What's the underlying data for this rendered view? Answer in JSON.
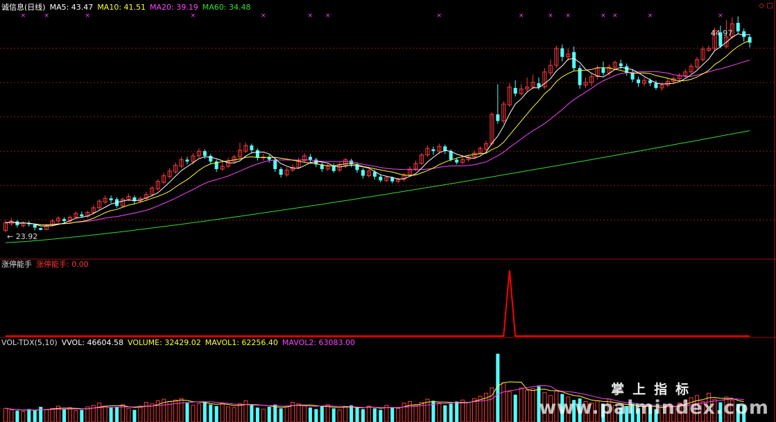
{
  "price_panel": {
    "title": "诚信息(日线)",
    "ma5_label": "MA5: 43.47",
    "ma10_label": "MA10: 41.51",
    "ma20_label": "MA20: 39.19",
    "ma60_label": "MA60: 34.48",
    "high_marker": "44.97",
    "low_marker": "← 23.92",
    "corner_diamond": "◇",
    "corner_box": "□"
  },
  "indicator_panel": {
    "name": "涨停能手",
    "value_label": "涨停能手: 0.00"
  },
  "volume_panel": {
    "name": "VOL-TDX(5,10)",
    "vvol_label": "VVOL: 46604.58",
    "volume_label": "VOLUME: 32429.02",
    "mavol1_label": "MAVOL1: 62256.40",
    "mavol2_label": "MAVOL2: 63083.00"
  },
  "watermark": {
    "cn": "掌上指标",
    "url": "www.palmindex.com"
  },
  "colors": {
    "background": "#000000",
    "up": "#ff3b3b",
    "down": "#54ffff",
    "ma5": "#ffffff",
    "ma10": "#ffff33",
    "ma20": "#ff44ff",
    "ma60": "#33dd33",
    "grid": "#8a1a1a",
    "separator": "#a01010",
    "indicator": "#ff0000"
  },
  "chart_data": {
    "type": "candlestick",
    "price_range": [
      21,
      47
    ],
    "high": 44.97,
    "low": 23.92,
    "candles": [
      [
        23.9,
        24.7,
        25.0,
        23.7
      ],
      [
        24.6,
        24.9,
        25.2,
        24.4
      ],
      [
        24.85,
        24.45,
        25.0,
        24.2
      ],
      [
        24.4,
        24.7,
        24.9,
        24.2
      ],
      [
        24.7,
        24.55,
        24.9,
        24.3
      ],
      [
        24.5,
        24.2,
        24.6,
        23.9
      ],
      [
        24.15,
        23.95,
        24.2,
        23.92
      ],
      [
        24.0,
        24.4,
        24.6,
        23.92
      ],
      [
        24.5,
        24.9,
        25.1,
        24.3
      ],
      [
        24.9,
        25.2,
        25.4,
        24.7
      ],
      [
        25.1,
        24.9,
        25.3,
        24.6
      ],
      [
        24.9,
        25.3,
        25.5,
        24.7
      ],
      [
        25.3,
        25.7,
        25.9,
        25.1
      ],
      [
        25.6,
        25.4,
        25.9,
        25.2
      ],
      [
        25.4,
        25.8,
        26.0,
        25.2
      ],
      [
        25.8,
        26.3,
        26.6,
        25.6
      ],
      [
        26.3,
        27.0,
        27.2,
        26.1
      ],
      [
        26.9,
        27.3,
        27.6,
        26.7
      ],
      [
        27.3,
        27.1,
        27.6,
        26.8
      ],
      [
        27.2,
        26.5,
        27.4,
        26.3
      ],
      [
        26.5,
        27.2,
        27.4,
        26.3
      ],
      [
        27.2,
        27.5,
        27.8,
        27.0
      ],
      [
        27.4,
        27.0,
        27.6,
        26.7
      ],
      [
        27.0,
        27.3,
        27.5,
        26.8
      ],
      [
        27.3,
        27.7,
        28.0,
        27.1
      ],
      [
        27.7,
        28.4,
        28.6,
        27.5
      ],
      [
        28.3,
        29.1,
        29.3,
        28.1
      ],
      [
        29.0,
        29.7,
        30.0,
        28.8
      ],
      [
        29.6,
        30.2,
        30.5,
        29.4
      ],
      [
        30.1,
        30.8,
        31.1,
        29.9
      ],
      [
        30.7,
        31.4,
        31.7,
        30.5
      ],
      [
        31.4,
        31.2,
        31.7,
        30.9
      ],
      [
        31.2,
        31.8,
        32.1,
        30.9
      ],
      [
        31.8,
        32.3,
        32.6,
        31.6
      ],
      [
        32.3,
        31.8,
        32.5,
        31.5
      ],
      [
        31.8,
        31.2,
        32.0,
        30.9
      ],
      [
        31.2,
        30.4,
        31.4,
        30.1
      ],
      [
        30.4,
        30.7,
        31.1,
        30.2
      ],
      [
        30.7,
        31.2,
        31.6,
        30.5
      ],
      [
        31.2,
        31.7,
        31.9,
        31.0
      ],
      [
        31.7,
        32.4,
        33.2,
        31.5
      ],
      [
        32.3,
        32.9,
        33.2,
        32.1
      ],
      [
        32.9,
        32.4,
        33.1,
        32.1
      ],
      [
        32.4,
        31.6,
        32.6,
        31.3
      ],
      [
        31.6,
        31.7,
        32.0,
        31.3
      ],
      [
        31.7,
        31.4,
        31.9,
        31.1
      ],
      [
        31.4,
        30.4,
        31.6,
        30.1
      ],
      [
        30.4,
        29.8,
        30.6,
        29.5
      ],
      [
        29.8,
        30.3,
        30.6,
        29.6
      ],
      [
        30.3,
        30.6,
        30.9,
        30.1
      ],
      [
        30.6,
        31.3,
        31.6,
        30.4
      ],
      [
        31.3,
        31.8,
        32.1,
        31.1
      ],
      [
        31.7,
        31.4,
        32.0,
        31.1
      ],
      [
        31.4,
        30.9,
        31.6,
        30.6
      ],
      [
        30.9,
        30.4,
        31.1,
        30.1
      ],
      [
        30.4,
        30.7,
        31.0,
        30.2
      ],
      [
        30.7,
        30.2,
        31.0,
        30.0
      ],
      [
        30.3,
        30.9,
        31.1,
        30.1
      ],
      [
        30.8,
        31.4,
        31.6,
        30.5
      ],
      [
        31.3,
        30.9,
        31.5,
        30.6
      ],
      [
        30.9,
        30.3,
        31.1,
        30.0
      ],
      [
        30.3,
        29.7,
        30.5,
        29.4
      ],
      [
        29.7,
        30.2,
        30.4,
        29.5
      ],
      [
        30.1,
        29.6,
        30.3,
        29.3
      ],
      [
        29.6,
        29.2,
        29.8,
        29.0
      ],
      [
        29.2,
        29.5,
        29.7,
        29.0
      ],
      [
        29.5,
        29.1,
        29.6,
        28.9
      ],
      [
        29.1,
        29.3,
        29.5,
        28.9
      ],
      [
        29.3,
        29.8,
        30.0,
        29.1
      ],
      [
        29.8,
        30.4,
        30.7,
        29.6
      ],
      [
        30.4,
        31.0,
        31.3,
        30.2
      ],
      [
        31.0,
        31.9,
        32.1,
        30.8
      ],
      [
        31.9,
        32.6,
        32.9,
        31.7
      ],
      [
        32.5,
        32.3,
        32.8,
        31.9
      ],
      [
        32.3,
        32.8,
        33.1,
        32.0
      ],
      [
        32.8,
        32.3,
        33.0,
        32.0
      ],
      [
        32.3,
        31.4,
        32.5,
        31.2
      ],
      [
        31.4,
        31.1,
        31.6,
        30.9
      ],
      [
        31.1,
        31.4,
        31.7,
        30.9
      ],
      [
        31.4,
        31.7,
        31.9,
        31.2
      ],
      [
        31.7,
        32.1,
        32.4,
        31.5
      ],
      [
        32.1,
        32.6,
        32.8,
        31.9
      ],
      [
        32.5,
        33.1,
        33.4,
        32.3
      ],
      [
        33.1,
        36.2,
        36.4,
        32.9
      ],
      [
        36.2,
        35.5,
        39.4,
        35.2
      ],
      [
        35.5,
        37.3,
        37.6,
        35.2
      ],
      [
        37.2,
        39.1,
        39.5,
        37.0
      ],
      [
        39.0,
        38.4,
        39.8,
        38.1
      ],
      [
        38.4,
        38.9,
        39.4,
        38.2
      ],
      [
        38.9,
        39.1,
        40.1,
        38.6
      ],
      [
        39.1,
        39.6,
        40.4,
        38.9
      ],
      [
        39.5,
        39.1,
        40.1,
        38.8
      ],
      [
        39.1,
        40.7,
        41.1,
        38.9
      ],
      [
        40.6,
        41.4,
        42.0,
        40.3
      ],
      [
        41.4,
        43.2,
        43.5,
        41.1
      ],
      [
        43.2,
        42.3,
        43.6,
        41.8
      ],
      [
        42.3,
        42.6,
        43.2,
        41.9
      ],
      [
        42.8,
        41.1,
        43.4,
        40.8
      ],
      [
        41.1,
        39.3,
        41.4,
        38.9
      ],
      [
        39.3,
        39.6,
        40.1,
        39.0
      ],
      [
        39.6,
        40.2,
        40.5,
        39.2
      ],
      [
        40.2,
        41.1,
        41.4,
        39.9
      ],
      [
        41.1,
        40.6,
        41.8,
        40.3
      ],
      [
        40.6,
        41.2,
        41.5,
        40.3
      ],
      [
        41.2,
        41.7,
        41.9,
        40.9
      ],
      [
        41.6,
        41.3,
        42.0,
        41.0
      ],
      [
        41.3,
        40.6,
        41.6,
        40.3
      ],
      [
        40.6,
        39.9,
        41.0,
        39.6
      ],
      [
        39.9,
        39.5,
        40.2,
        39.1
      ],
      [
        39.5,
        39.8,
        40.1,
        39.2
      ],
      [
        39.8,
        39.5,
        40.0,
        39.2
      ],
      [
        39.5,
        39.0,
        39.8,
        38.8
      ],
      [
        39.0,
        39.3,
        39.6,
        38.7
      ],
      [
        39.3,
        39.7,
        40.0,
        39.1
      ],
      [
        39.7,
        40.0,
        40.2,
        39.4
      ],
      [
        40.0,
        40.3,
        40.6,
        39.8
      ],
      [
        40.3,
        40.7,
        41.0,
        40.1
      ],
      [
        40.7,
        41.3,
        41.6,
        40.5
      ],
      [
        41.2,
        42.0,
        42.3,
        41.0
      ],
      [
        42.0,
        43.1,
        43.4,
        41.8
      ],
      [
        43.0,
        43.2,
        43.5,
        42.8
      ],
      [
        43.2,
        45.1,
        45.4,
        43.0
      ],
      [
        44.9,
        43.4,
        45.6,
        43.2
      ],
      [
        43.4,
        44.4,
        46.2,
        43.2
      ],
      [
        44.4,
        45.8,
        46.5,
        44.2
      ],
      [
        45.9,
        45.0,
        46.6,
        44.7
      ],
      [
        45.0,
        44.4,
        45.3,
        43.9
      ],
      [
        44.4,
        43.8,
        44.7,
        43.3
      ]
    ],
    "ma60_end": 34.48,
    "indicator": {
      "range": [
        0,
        1
      ],
      "spike_index": 86,
      "spike_value": 1
    },
    "volume": {
      "range": [
        0,
        95000
      ],
      "values": [
        18000,
        16000,
        15000,
        14000,
        17000,
        15000,
        20000,
        16000,
        18000,
        21000,
        17000,
        19000,
        15000,
        16000,
        20000,
        22000,
        25000,
        21000,
        19000,
        20000,
        23000,
        18000,
        16000,
        21000,
        26000,
        24000,
        28000,
        30000,
        27000,
        29000,
        31000,
        25000,
        22000,
        24000,
        27000,
        23000,
        21000,
        25000,
        20000,
        19000,
        24000,
        28000,
        22000,
        19000,
        17000,
        20000,
        23000,
        18000,
        21000,
        26000,
        24000,
        22000,
        19000,
        17000,
        21000,
        23000,
        18000,
        16000,
        20000,
        22000,
        19000,
        17000,
        21000,
        18000,
        16000,
        22000,
        19000,
        18000,
        25000,
        27000,
        23000,
        26000,
        30000,
        28000,
        25000,
        22000,
        24000,
        27000,
        29000,
        26000,
        31000,
        34000,
        38000,
        45000,
        90000,
        52000,
        40000,
        36000,
        45000,
        42000,
        44000,
        47000,
        39000,
        35000,
        41000,
        37000,
        33000,
        29000,
        31000,
        27000,
        25000,
        28000,
        24000,
        30000,
        22000,
        19000,
        21000,
        24000,
        18000,
        20000,
        22000,
        17000,
        19000,
        23000,
        21000,
        25000,
        28000,
        32000,
        35000,
        27000,
        38000,
        30000,
        26000,
        33000,
        29000,
        24000,
        22000
      ]
    }
  }
}
